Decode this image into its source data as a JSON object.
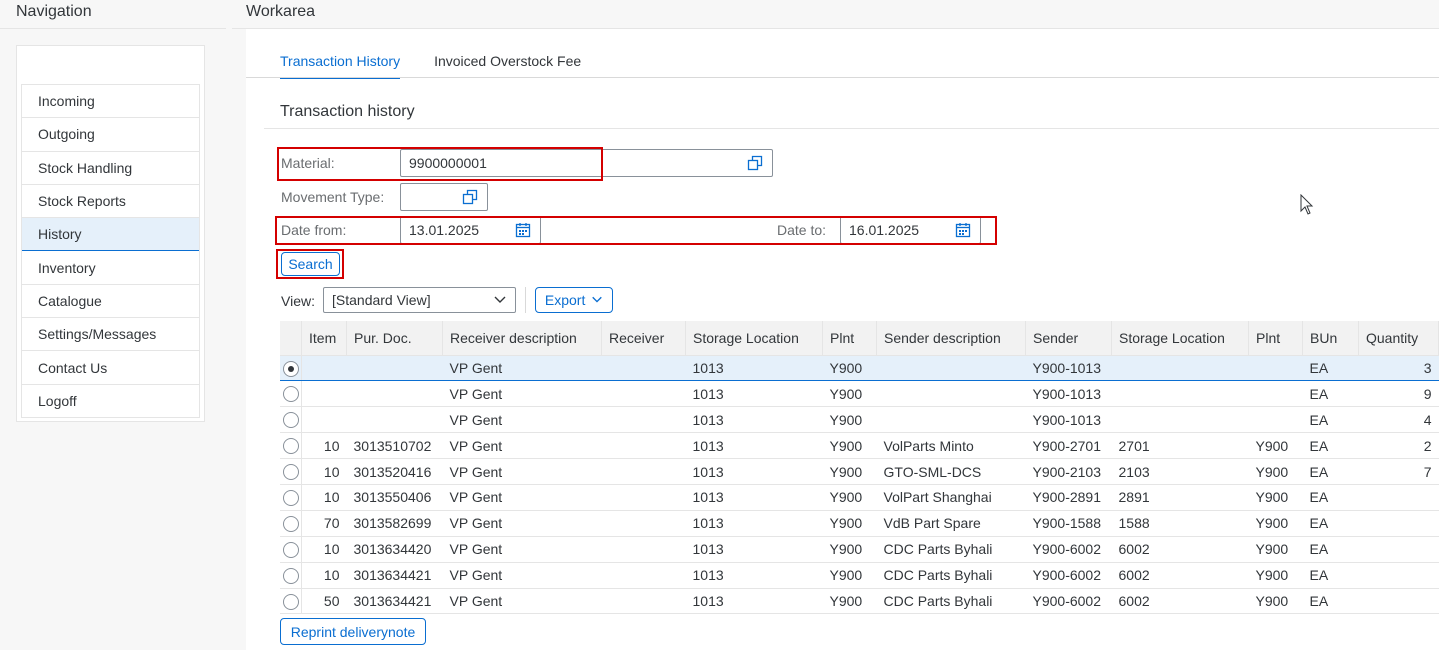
{
  "navigation": {
    "title": "Navigation",
    "items": [
      {
        "label": "Incoming"
      },
      {
        "label": "Outgoing"
      },
      {
        "label": "Stock Handling"
      },
      {
        "label": "Stock Reports"
      },
      {
        "label": "History",
        "active": true
      },
      {
        "label": "Inventory"
      },
      {
        "label": "Catalogue"
      },
      {
        "label": "Settings/Messages"
      },
      {
        "label": "Contact Us"
      },
      {
        "label": "Logoff"
      }
    ]
  },
  "workarea": {
    "title": "Workarea",
    "tabs": [
      {
        "label": "Transaction History",
        "active": true
      },
      {
        "label": "Invoiced Overstock Fee"
      }
    ],
    "section_title": "Transaction history"
  },
  "form": {
    "material_label": "Material:",
    "material_value": "9900000001",
    "movement_type_label": "Movement Type:",
    "movement_type_value": "",
    "date_from_label": "Date from:",
    "date_from_value": "13.01.2025",
    "date_to_label": "Date to:",
    "date_to_value": "16.01.2025",
    "search_label": "Search"
  },
  "toolbar": {
    "view_label": "View:",
    "view_value": "[Standard View]",
    "export_label": "Export"
  },
  "table": {
    "columns": [
      "Item",
      "Pur. Doc.",
      "Receiver description",
      "Receiver",
      "Storage Location",
      "Plnt",
      "Sender description",
      "Sender",
      "Storage Location",
      "Plnt",
      "BUn",
      "Quantity"
    ],
    "rows": [
      {
        "selected": true,
        "cells": [
          "",
          "",
          "VP Gent",
          "",
          "1013",
          "Y900",
          "",
          "Y900-1013",
          "",
          "",
          "EA",
          "3"
        ]
      },
      {
        "selected": false,
        "cells": [
          "",
          "",
          "VP Gent",
          "",
          "1013",
          "Y900",
          "",
          "Y900-1013",
          "",
          "",
          "EA",
          "9"
        ]
      },
      {
        "selected": false,
        "cells": [
          "",
          "",
          "VP Gent",
          "",
          "1013",
          "Y900",
          "",
          "Y900-1013",
          "",
          "",
          "EA",
          "4"
        ]
      },
      {
        "selected": false,
        "cells": [
          "10",
          "3013510702",
          "VP Gent",
          "",
          "1013",
          "Y900",
          "VolParts Minto",
          "Y900-2701",
          "2701",
          "Y900",
          "EA",
          "2"
        ]
      },
      {
        "selected": false,
        "cells": [
          "10",
          "3013520416",
          "VP Gent",
          "",
          "1013",
          "Y900",
          "GTO-SML-DCS",
          "Y900-2103",
          "2103",
          "Y900",
          "EA",
          "7"
        ]
      },
      {
        "selected": false,
        "cells": [
          "10",
          "3013550406",
          "VP Gent",
          "",
          "1013",
          "Y900",
          "VolPart Shanghai",
          "Y900-2891",
          "2891",
          "Y900",
          "EA",
          ""
        ]
      },
      {
        "selected": false,
        "cells": [
          "70",
          "3013582699",
          "VP Gent",
          "",
          "1013",
          "Y900",
          "VdB Part Spare",
          "Y900-1588",
          "1588",
          "Y900",
          "EA",
          ""
        ]
      },
      {
        "selected": false,
        "cells": [
          "10",
          "3013634420",
          "VP Gent",
          "",
          "1013",
          "Y900",
          "CDC Parts Byhali",
          "Y900-6002",
          "6002",
          "Y900",
          "EA",
          ""
        ]
      },
      {
        "selected": false,
        "cells": [
          "10",
          "3013634421",
          "VP Gent",
          "",
          "1013",
          "Y900",
          "CDC Parts Byhali",
          "Y900-6002",
          "6002",
          "Y900",
          "EA",
          ""
        ]
      },
      {
        "selected": false,
        "cells": [
          "50",
          "3013634421",
          "VP Gent",
          "",
          "1013",
          "Y900",
          "CDC Parts Byhali",
          "Y900-6002",
          "6002",
          "Y900",
          "EA",
          ""
        ]
      }
    ]
  },
  "footer": {
    "reprint_label": "Reprint deliverynote"
  },
  "colors": {
    "accent": "#0a6ed1",
    "highlight_box": "#d40000",
    "selected_row": "#e5f0fa"
  }
}
